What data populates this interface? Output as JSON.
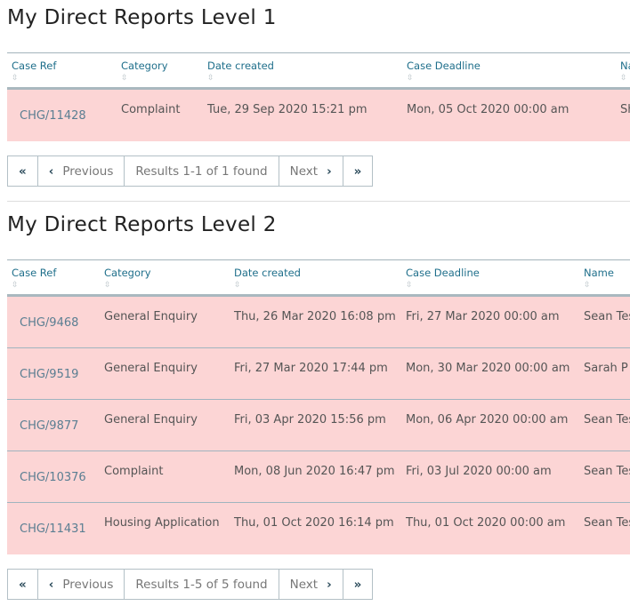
{
  "section1": {
    "title": "My Direct Reports Level 1",
    "columns": [
      "Case Ref",
      "Category",
      "Date created",
      "Case Deadline",
      "Name"
    ],
    "rows": [
      [
        "CHG/11428",
        "Complaint",
        "Tue, 29 Sep 2020 15:21 pm",
        "Mon, 05 Oct 2020 00:00 am",
        "Sh"
      ]
    ],
    "pager": {
      "first": "«",
      "prev": "Previous",
      "results": "Results 1-1 of 1 found",
      "next": "Next",
      "last": "»"
    }
  },
  "section2": {
    "title": "My Direct Reports Level 2",
    "columns": [
      "Case Ref",
      "Category",
      "Date created",
      "Case Deadline",
      "Name"
    ],
    "rows": [
      [
        "CHG/9468",
        "General Enquiry",
        "Thu, 26 Mar 2020 16:08 pm",
        "Fri, 27 Mar 2020 00:00 am",
        "Sean Tes"
      ],
      [
        "CHG/9519",
        "General Enquiry",
        "Fri, 27 Mar 2020 17:44 pm",
        "Mon, 30 Mar 2020 00:00 am",
        "Sarah P"
      ],
      [
        "CHG/9877",
        "General Enquiry",
        "Fri, 03 Apr 2020 15:56 pm",
        "Mon, 06 Apr 2020 00:00 am",
        "Sean Tes"
      ],
      [
        "CHG/10376",
        "Complaint",
        "Mon, 08 Jun 2020 16:47 pm",
        "Fri, 03 Jul 2020 00:00 am",
        "Sean Tes"
      ],
      [
        "CHG/11431",
        "Housing Application",
        "Thu, 01 Oct 2020 16:14 pm",
        "Thu, 01 Oct 2020 00:00 am",
        "Sean Tes"
      ]
    ],
    "pager": {
      "first": "«",
      "prev": "Previous",
      "results": "Results 1-5 of 5 found",
      "next": "Next",
      "last": "»"
    }
  },
  "colors": {
    "row_highlight": "#fcd5d5",
    "header_text": "#1f6f8b",
    "link": "#5a7e92"
  }
}
